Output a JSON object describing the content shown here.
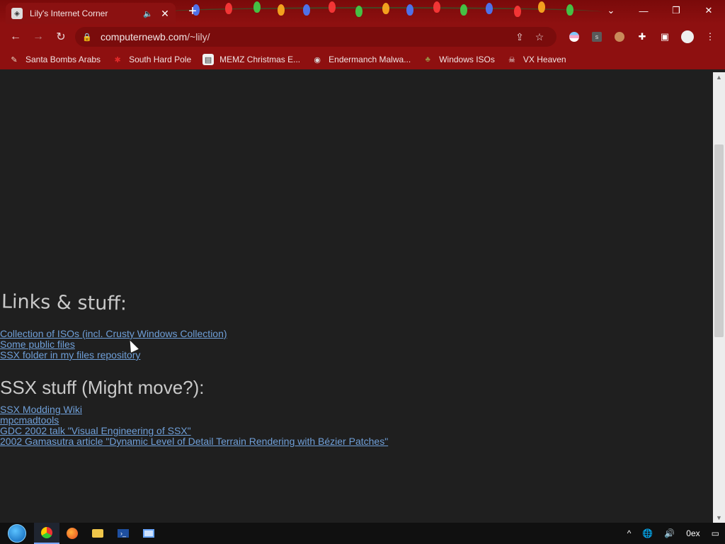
{
  "browser": {
    "tab_title": "Lily's Internet Corner",
    "url_host": "computernewb.com",
    "url_path": "/~lily/"
  },
  "bookmarks": [
    {
      "label": "Santa Bombs Arabs",
      "icon": "bookmark-icon",
      "color": "#e8d6c2"
    },
    {
      "label": "South Hard Pole",
      "icon": "spider-icon",
      "color": "#e12a2a"
    },
    {
      "label": "MEMZ Christmas E...",
      "icon": "image-icon",
      "color": "#f1f1f1"
    },
    {
      "label": "Endermanch Malwa...",
      "icon": "raccoon-icon",
      "color": "#d8d8d8"
    },
    {
      "label": "Windows ISOs",
      "icon": "tree-icon",
      "color": "#9a8d44"
    },
    {
      "label": "VX Heaven",
      "icon": "skull-icon",
      "color": "#eeeeee"
    }
  ],
  "page": {
    "links_heading": "Links & stuff:",
    "links": [
      "Collection of ISOs (incl. Crusty Windows Collection)",
      "Some public files",
      "SSX folder in my files repository"
    ],
    "ssx_heading": "SSX stuff (Might move?):",
    "ssx_links": [
      "SSX Modding Wiki",
      "mpcmadtools",
      "GDC 2002 talk \"Visual Engineering of SSX\"",
      "2002 Gamasutra article \"Dynamic Level of Detail Terrain Rendering with Bézier Patches\""
    ]
  },
  "taskbar": {
    "tray_text": "0ex"
  },
  "colors": {
    "chrome": "#8e1010",
    "page_bg": "#1f1f1f",
    "link": "#6f9fd8"
  }
}
